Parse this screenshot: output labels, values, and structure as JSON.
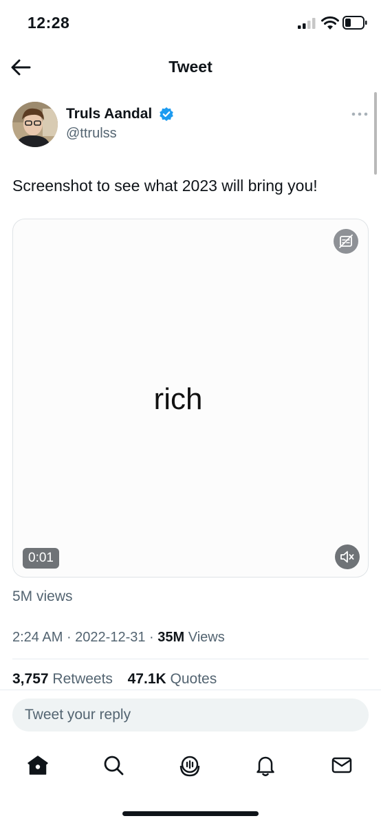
{
  "status_bar": {
    "time": "12:28"
  },
  "header": {
    "title": "Tweet"
  },
  "author": {
    "name": "Truls Aandal",
    "handle": "@ttrulss"
  },
  "tweet": {
    "text": "Screenshot to see what 2023 will bring you!",
    "media": {
      "word": "rich",
      "duration": "0:01"
    },
    "views_text": "5M views",
    "time": "2:24 AM",
    "separator": " · ",
    "date": "2022-12-31",
    "views_count": "35M",
    "views_label": " Views"
  },
  "stats": {
    "retweets_count": "3,757",
    "retweets_label": " Retweets",
    "quotes_count": "47.1K",
    "quotes_label": " Quotes"
  },
  "reply": {
    "placeholder": "Tweet your reply"
  },
  "tab_bar": {
    "items": [
      {
        "icon": "home-icon"
      },
      {
        "icon": "search-icon"
      },
      {
        "icon": "spaces-icon"
      },
      {
        "icon": "notifications-icon"
      },
      {
        "icon": "messages-icon"
      }
    ]
  },
  "colors": {
    "verified": "#1d9bf0",
    "secondary_text": "#536471",
    "primary_text": "#0f1419"
  }
}
